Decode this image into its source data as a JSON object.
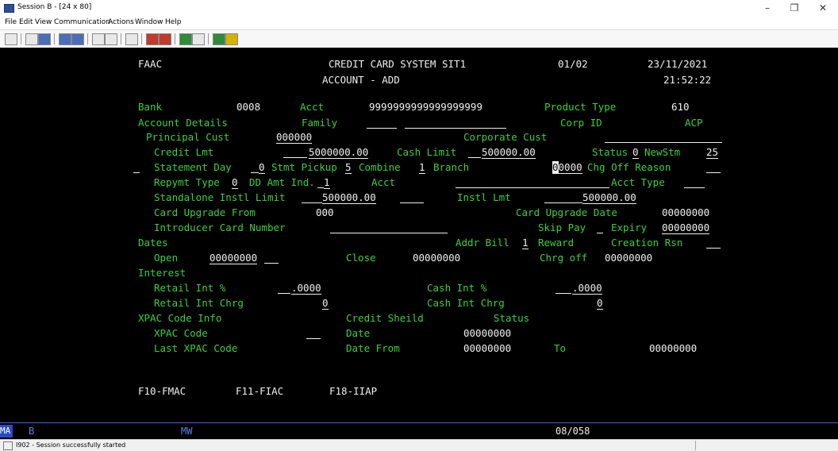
{
  "window": {
    "title": "Session B - [24 x 80]",
    "minimize": "–",
    "maximize": "❐",
    "close": "✕"
  },
  "menu": [
    "File",
    "Edit",
    "View",
    "Communication",
    "Actions",
    "Window",
    "Help"
  ],
  "screen": {
    "r1": {
      "code": "FAAC",
      "system": "CREDIT CARD SYSTEM SIT1",
      "page": "01/02",
      "date": "23/11/2021"
    },
    "r2": {
      "mode": "ACCOUNT - ADD",
      "time": "21:52:22"
    },
    "r3": {
      "bank_label": "Bank",
      "bank_value": "0008",
      "acct_label": "Acct",
      "acct_value": "9999999999999999999",
      "product_label": "Product Type",
      "product_value": "610"
    },
    "r4": {
      "details_label": "Account Details",
      "family_label": "Family",
      "corp_label": "Corp ID",
      "corp_value": "ACP"
    },
    "r5": {
      "principal_label": "Principal Cust",
      "principal_value": "000000",
      "corporate_label": "Corporate Cust"
    },
    "r6": {
      "credit_label": "Credit Lmt",
      "credit_value": "5000000.00",
      "cash_label": "Cash Limit",
      "cash_value": "500000.00",
      "status_label": "Status",
      "status_value": "0",
      "newstm_label": "NewStm",
      "newstm_value": "25"
    },
    "r7": {
      "stmt_day_label": "Statement Day",
      "stmt_day_value": "0",
      "pickup_label": "Stmt Pickup",
      "pickup_value": "5",
      "combine_label": "Combine",
      "combine_value": "1",
      "branch_label": "Branch",
      "branch_cursor": "0",
      "branch_value": "0000",
      "chgoff_label": "Chg Off Reason"
    },
    "r8": {
      "repymt_label": "Repymt Type",
      "repymt_value": "0",
      "dd_label": "DD Amt Ind.",
      "dd_value": "1",
      "acct_label": "Acct",
      "accttype_label": "Acct Type"
    },
    "r9": {
      "standalone_label": "Standalone Instl Limit",
      "standalone_value": "500000.00",
      "instl_label": "Instl Lmt",
      "instl_value": "500000.00"
    },
    "r10": {
      "upgrade_from_label": "Card Upgrade From",
      "upgrade_from_value": "000",
      "upgrade_date_label": "Card Upgrade Date",
      "upgrade_date_value": "00000000"
    },
    "r11": {
      "introducer_label": "Introducer Card Number",
      "skip_label": "Skip Pay",
      "expiry_label": "Expiry",
      "expiry_value": "00000000"
    },
    "r12": {
      "dates_label": "Dates",
      "addr_label": "Addr Bill",
      "addr_value": "1",
      "reward_label": "Reward",
      "creation_label": "Creation Rsn"
    },
    "r13": {
      "open_label": "Open",
      "open_value": "00000000",
      "close_label": "Close",
      "close_value": "00000000",
      "chrgoff_label": "Chrg off",
      "chrgoff_value": "00000000"
    },
    "r14": {
      "interest_label": "Interest"
    },
    "r15": {
      "retail_int_label": "Retail Int %",
      "retail_int_value": ".0000",
      "cash_int_label": "Cash Int %",
      "cash_int_value": ".0000"
    },
    "r16": {
      "retail_chrg_label": "Retail Int Chrg",
      "retail_chrg_value": "0",
      "cash_chrg_label": "Cash Int Chrg",
      "cash_chrg_value": "0"
    },
    "r17": {
      "xpac_info_label": "XPAC Code Info",
      "credit_sheild_label": "Credit Sheild",
      "status_label": "Status"
    },
    "r18": {
      "xpac_label": "XPAC Code",
      "date_label": "Date",
      "date_value": "00000000"
    },
    "r19": {
      "last_xpac_label": "Last XPAC Code",
      "date_from_label": "Date From",
      "date_from_value": "00000000",
      "to_label": "To",
      "to_value": "00000000"
    },
    "fkeys": {
      "f10": "F10-FMAC",
      "f11": "F11-FIAC",
      "f18": "F18-IIAP"
    }
  },
  "oia": {
    "ma": "MA",
    "session": "B",
    "mw": "MW",
    "cursor_pos": "08/058"
  },
  "statusbar": {
    "message": "I902 - Session successfully started"
  }
}
